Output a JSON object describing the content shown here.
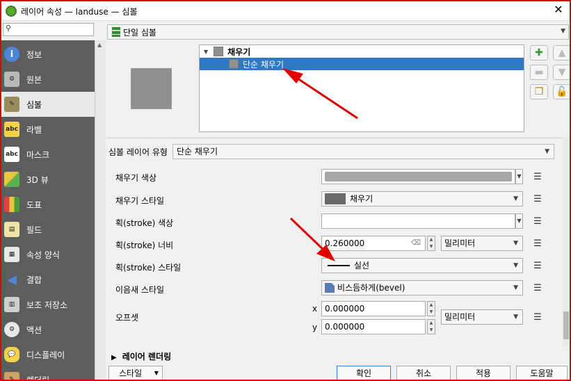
{
  "window": {
    "title": "레이어 속성 — landuse — 심볼"
  },
  "search": {
    "placeholder": ""
  },
  "sidebar": {
    "items": [
      {
        "label": "정보",
        "icon": "info-icon"
      },
      {
        "label": "원본",
        "icon": "source-icon"
      },
      {
        "label": "심볼",
        "icon": "symbology-icon"
      },
      {
        "label": "라벨",
        "icon": "labels-icon"
      },
      {
        "label": "마스크",
        "icon": "mask-icon"
      },
      {
        "label": "3D 뷰",
        "icon": "3d-view-icon"
      },
      {
        "label": "도표",
        "icon": "diagrams-icon"
      },
      {
        "label": "필드",
        "icon": "fields-icon"
      },
      {
        "label": "속성 양식",
        "icon": "attributes-form-icon"
      },
      {
        "label": "결합",
        "icon": "joins-icon"
      },
      {
        "label": "보조 저장소",
        "icon": "auxiliary-storage-icon"
      },
      {
        "label": "액션",
        "icon": "actions-icon"
      },
      {
        "label": "디스플레이",
        "icon": "display-icon"
      },
      {
        "label": "렌더링",
        "icon": "rendering-icon"
      }
    ],
    "active": "심볼"
  },
  "renderer": {
    "label": "단일 심볼"
  },
  "tree": {
    "root": "채우기",
    "child": "단순 채우기"
  },
  "layer_type": {
    "label": "심볼 레이어 유형",
    "value": "단순 채우기"
  },
  "props": {
    "fill_color": {
      "label": "채우기 색상",
      "color": "#a6a6a6"
    },
    "fill_style": {
      "label": "채우기 스타일",
      "value": "채우기"
    },
    "stroke_color": {
      "label": "획(stroke) 색상"
    },
    "stroke_width": {
      "label": "획(stroke) 너비",
      "value": "0.260000",
      "unit": "밀리미터"
    },
    "stroke_style": {
      "label": "획(stroke) 스타일",
      "value": "실선"
    },
    "join_style": {
      "label": "이음새 스타일",
      "value": "비스듬하게(bevel)"
    },
    "offset": {
      "label": "오프셋",
      "x_label": "x",
      "y_label": "y",
      "x": "0.000000",
      "y": "0.000000",
      "unit": "밀리미터"
    }
  },
  "section": {
    "layer_rendering": "레이어 렌더링"
  },
  "buttons": {
    "style": "스타일",
    "ok": "확인",
    "cancel": "취소",
    "apply": "적용",
    "help": "도움말"
  },
  "colors": {
    "accent": "#2f78c4",
    "annotation": "#e00000",
    "sidebar": "#5d5d5d"
  }
}
